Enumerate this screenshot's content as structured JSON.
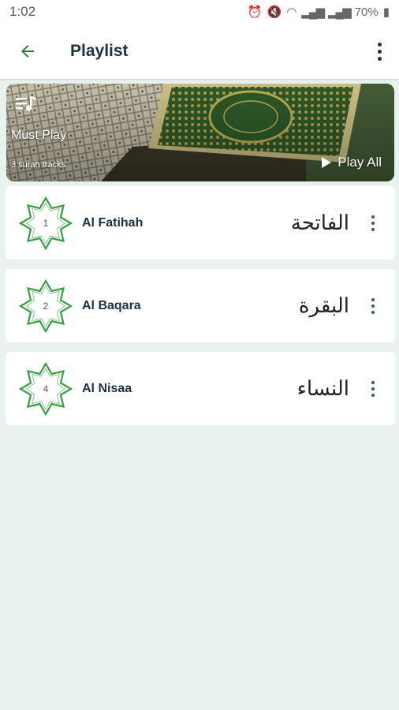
{
  "status_bar": {
    "time": "1:02",
    "battery": "70%"
  },
  "app_bar": {
    "title": "Playlist"
  },
  "playlist": {
    "name": "Must Play",
    "track_count": "3 surah tracks",
    "play_all_label": "Play All"
  },
  "surahs": [
    {
      "number": "1",
      "name": "Al Fatihah",
      "arabic": "الفاتحة"
    },
    {
      "number": "2",
      "name": "Al Baqara",
      "arabic": "البقرة"
    },
    {
      "number": "4",
      "name": "Al Nisaa",
      "arabic": "النساء"
    }
  ],
  "colors": {
    "accent": "#2e8b3e",
    "background": "#e9f2ef"
  }
}
